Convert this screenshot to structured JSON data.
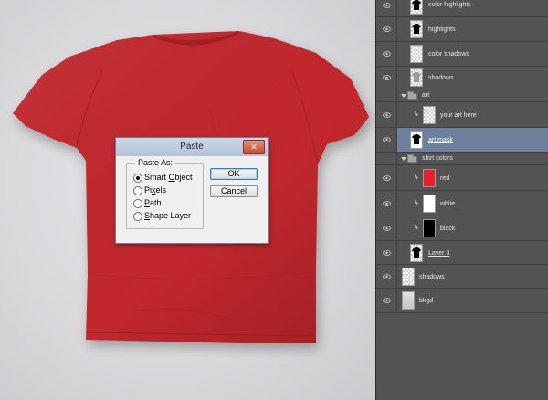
{
  "dialog": {
    "title": "Paste",
    "close_glyph": "✕",
    "group_label": "Paste As:",
    "options": [
      {
        "pre": "Smart ",
        "key": "O",
        "post": "bject",
        "checked": true
      },
      {
        "pre": "Pi",
        "key": "x",
        "post": "els",
        "checked": false
      },
      {
        "pre": "",
        "key": "P",
        "post": "ath",
        "checked": false
      },
      {
        "pre": "",
        "key": "S",
        "post": "hape Layer",
        "checked": false
      }
    ],
    "ok_label": "OK",
    "cancel_label": "Cancel"
  },
  "shirt": {
    "color": "#c1272d"
  },
  "layers": {
    "selected_color": "#6c7f9c",
    "rows": [
      {
        "name": "color highlights",
        "icon": "shirt-thumb",
        "visible": true
      },
      {
        "name": "highlights",
        "icon": "shirt-thumb",
        "visible": true
      },
      {
        "name": "color shadows",
        "icon": "blank-thumb",
        "visible": true
      },
      {
        "name": "shadows",
        "icon": "shadow-thumb",
        "visible": true
      },
      {
        "name": "art",
        "icon": "folder-icon",
        "group": true,
        "expanded": true
      },
      {
        "name": "your art here",
        "icon": "transparent-thumb",
        "visible": true,
        "clipped": true
      },
      {
        "name": "art mask",
        "icon": "shirt-thumb",
        "visible": true,
        "selected": true,
        "underlined": true
      },
      {
        "name": "shirt colors",
        "icon": "folder-icon",
        "group": true,
        "expanded": true
      },
      {
        "name": "red",
        "icon": "color-swatch",
        "swatch": "#e8202a",
        "visible": true,
        "clipped": true
      },
      {
        "name": "white",
        "icon": "color-swatch",
        "swatch": "#ffffff",
        "visible": true,
        "clipped": true
      },
      {
        "name": "black",
        "icon": "color-swatch",
        "swatch": "#000000",
        "visible": true,
        "clipped": true
      },
      {
        "name": "Layer 3",
        "icon": "shirt-thumb",
        "visible": true,
        "underlined": true
      },
      {
        "name": "shadows",
        "icon": "transparent-thumb",
        "visible": true
      },
      {
        "name": "bkgd",
        "icon": "bkgd-thumb",
        "visible": true
      }
    ]
  }
}
